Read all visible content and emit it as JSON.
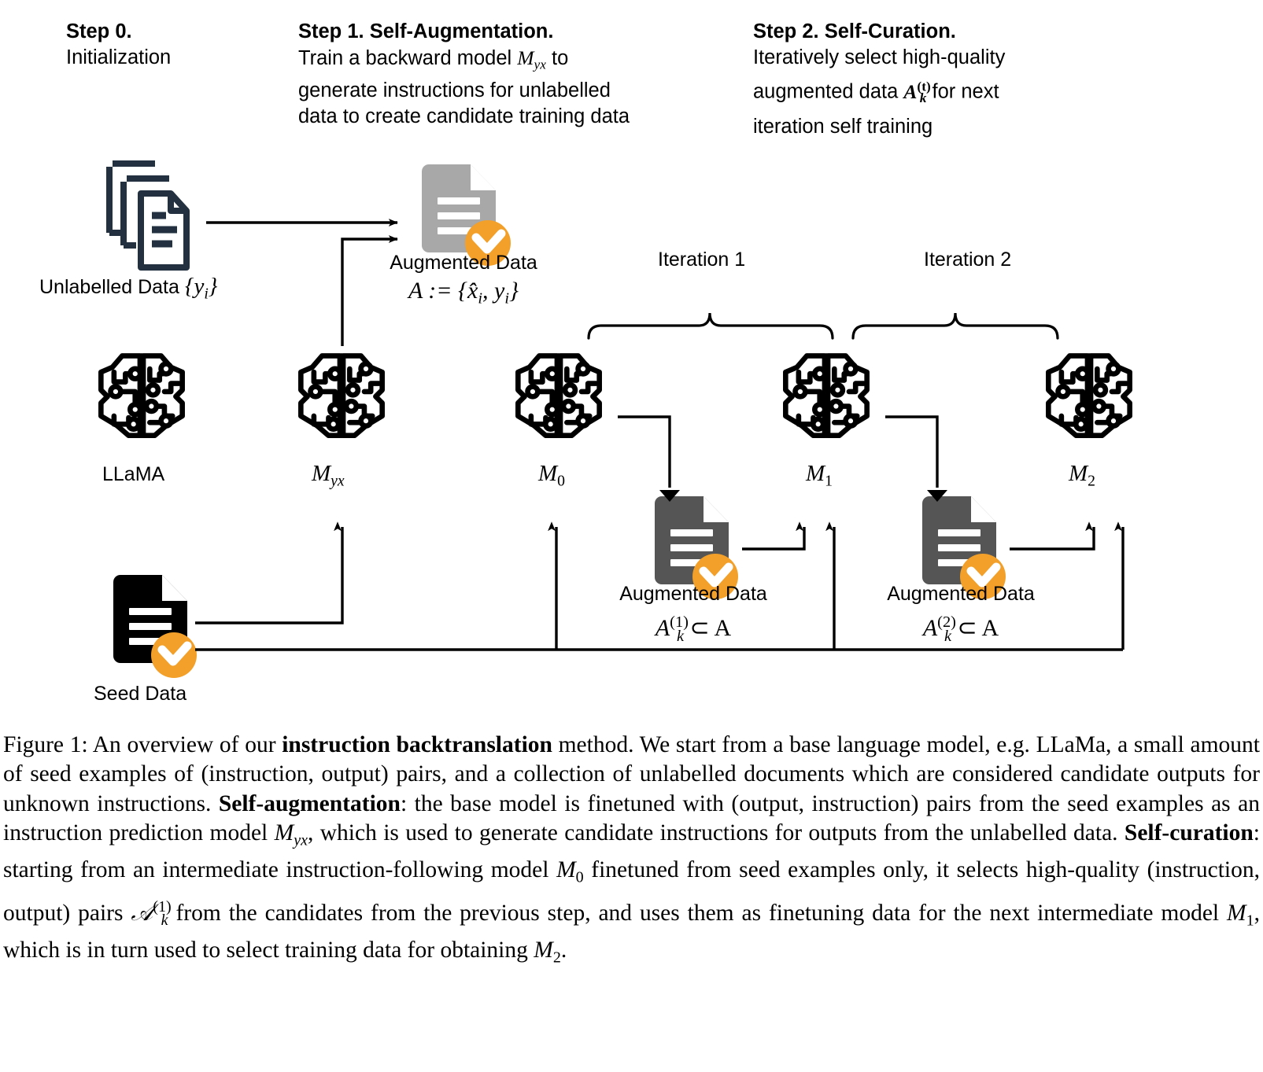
{
  "figure": {
    "id": "figure-1-instruction-backtranslation",
    "type": "diagram"
  },
  "steps": [
    {
      "id": "step-0",
      "title": "Step 0.",
      "body_lines": [
        "Initialization"
      ]
    },
    {
      "id": "step-1",
      "title": "Step 1. Self-Augmentation.",
      "body_line_1_a": "Train a backward model ",
      "body_line_1_math": "M",
      "body_line_1_math_sub": "yx",
      "body_line_1_b": " to",
      "body_line_2": "generate instructions for unlabelled",
      "body_line_3": "data to create candidate training data"
    },
    {
      "id": "step-2",
      "title": "Step 2. Self-Curation.",
      "body_line_1": "Iteratively select high-quality",
      "body_line_2_a": "augmented data ",
      "body_line_2_math": "A",
      "body_line_2_math_sub": "k",
      "body_line_2_math_sup": "(t)",
      "body_line_2_b": " for next",
      "body_line_3": "iteration self training"
    }
  ],
  "nodes": {
    "unlabelled_data": {
      "icon": "document-stack-icon",
      "label_text": "Unlabelled Data ",
      "label_math": "{y",
      "label_math_sub": "i",
      "label_math_close": "}",
      "color": "#22303f"
    },
    "augmented_data_top": {
      "icon": "document-check-icon",
      "label_text": "Augmented Data",
      "label_math_a": "A := ",
      "label_math_b": "{x̂",
      "label_math_sub1": "i",
      "label_math_c": ", y",
      "label_math_sub2": "i",
      "label_math_d": "}",
      "doc_color": "#a8a8a8",
      "badge_color": "#f2a029"
    },
    "llama": {
      "icon": "brain-circuit-icon",
      "label": "LLaMA"
    },
    "model_myx": {
      "icon": "brain-circuit-icon",
      "label_math": "M",
      "label_math_sub": "yx"
    },
    "model_m0": {
      "icon": "brain-circuit-icon",
      "label_math": "M",
      "label_math_sub": "0"
    },
    "model_m1": {
      "icon": "brain-circuit-icon",
      "label_math": "M",
      "label_math_sub": "1"
    },
    "model_m2": {
      "icon": "brain-circuit-icon",
      "label_math": "M",
      "label_math_sub": "2"
    },
    "seed_data": {
      "icon": "document-check-icon",
      "label": "Seed Data",
      "doc_color": "#000000",
      "badge_color": "#f2a029"
    },
    "augmented_data_it1": {
      "icon": "document-check-icon",
      "label_text": "Augmented Data",
      "label_math": "A",
      "label_math_sub": "k",
      "label_math_sup": "(1)",
      "label_math_tail": " ⊂ A",
      "doc_color": "#555555",
      "badge_color": "#f2a029"
    },
    "augmented_data_it2": {
      "icon": "document-check-icon",
      "label_text": "Augmented Data",
      "label_math": "A",
      "label_math_sub": "k",
      "label_math_sup": "(2)",
      "label_math_tail": " ⊂ A",
      "doc_color": "#555555",
      "badge_color": "#f2a029"
    }
  },
  "brackets": [
    {
      "id": "iteration-1",
      "label": "Iteration 1"
    },
    {
      "id": "iteration-2",
      "label": "Iteration 2"
    }
  ],
  "caption": {
    "p1": "Figure 1: An overview of our ",
    "b1": "instruction backtranslation",
    "p2": " method. We start from a base language model, e.g. LLaMa, a small amount of seed examples of (instruction, output) pairs, and a collection of unlabelled documents which are considered candidate outputs for unknown instructions. ",
    "b2": "Self-augmentation",
    "p3": ": the base model is finetuned with (output, instruction) pairs from the seed examples as an instruction prediction model ",
    "m1": "M",
    "m1sub": "yx",
    "p4": ", which is used to generate candidate instructions for outputs from the unlabelled data. ",
    "b3": "Self-curation",
    "p5": ": starting from an intermediate instruction-following model ",
    "m2": "M",
    "m2sub": "0",
    "p6": " finetuned from seed examples only, it selects high-quality (instruction, output) pairs ",
    "m3": "𝒜",
    "m3sub": "k",
    "m3sup": "(1)",
    "p7": " from the candidates from the previous step, and uses them as finetuning data for the next intermediate model ",
    "m4": "M",
    "m4sub": "1",
    "p8": ", which is in turn used to select training data for obtaining ",
    "m5": "M",
    "m5sub": "2",
    "p9": "."
  },
  "colors": {
    "accent_orange": "#f2a029",
    "navy": "#22303f",
    "gray_doc": "#a8a8a8",
    "dark_gray_doc": "#555555",
    "black": "#000000"
  }
}
